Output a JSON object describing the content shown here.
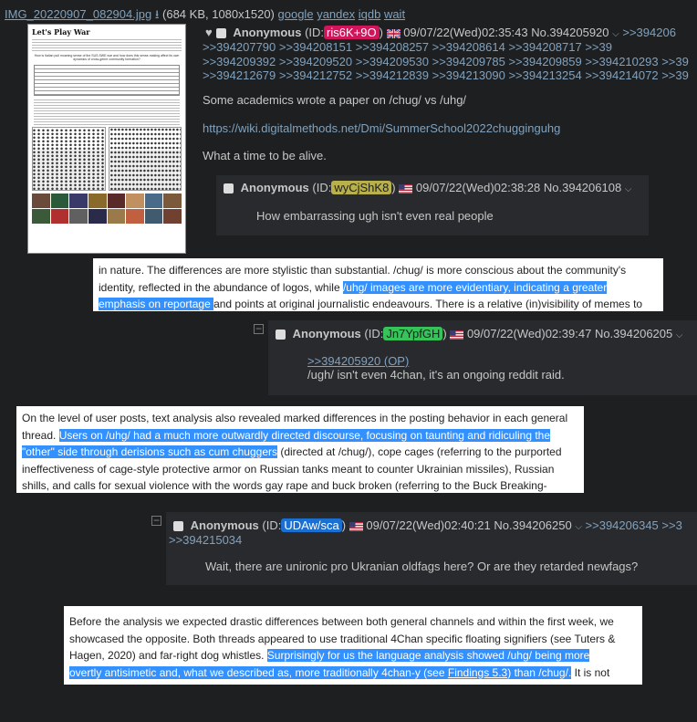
{
  "fileinfo": {
    "filename": "IMG_20220907_082904.jpg",
    "meta": "(684 KB, 1080x1520)",
    "links": [
      "google",
      "yandex",
      "iqdb",
      "wait"
    ]
  },
  "thumbnail": {
    "title": "Let's Play War",
    "caption": "How is Italian pull moaning sense of the SUS.SWE war and how does this sense-making affect its own dynamics of cross-genre community formation?"
  },
  "op": {
    "name": "Anonymous",
    "id_prefix": "(ID:",
    "id": "ris6K+9O",
    "id_suffix": ")",
    "datetime": "09/07/22(Wed)02:35:43",
    "no": "No.394205920",
    "backlinks_row0": ">>394206",
    "backlinks_rows": [
      ">>394207790 >>394208151 >>394208257 >>394208614 >>394208717 >>39",
      ">>394209392 >>394209520 >>394209530 >>394209785 >>394209859 >>394210293 >>39",
      ">>394212679 >>394212752 >>394212839 >>394213090 >>394213254 >>394214072 >>39"
    ],
    "text1": "Some academics wrote a paper on /chug/ vs /uhg/",
    "link": "https://wiki.digitalmethods.net/Dmi/SummerSchool2022chugginguhg",
    "text2": "What a time to be alive."
  },
  "reply1": {
    "name": "Anonymous",
    "id_prefix": "(ID:",
    "id": "wyCjShK8",
    "id_suffix": ")",
    "datetime": "09/07/22(Wed)02:38:28",
    "no": "No.394206108",
    "text": "How embarrassing ugh isn't even real people"
  },
  "popup1": {
    "l1": "in nature. The differences are more stylistic than substantial. /chug/ is more conscious about the community's",
    "l2a": "identity, reflected in the abundance of logos, while ",
    "l2b": "/uhg/ images are more evidentiary, indicating a greater",
    "l3a": "emphasis on reportage ",
    "l3b": "and points at original journalistic endeavours. There is a relative (in)visibility of memes to"
  },
  "reply2": {
    "name": "Anonymous",
    "id_prefix": "(ID:",
    "id": "Jn7YpfGH",
    "id_suffix": ")",
    "datetime": "09/07/22(Wed)02:39:47",
    "no": "No.394206205",
    "quote": ">>394205920 (OP)",
    "text": "/ugh/ isn't even 4chan, it's an ongoing reddit raid."
  },
  "popup2": {
    "l1": "On the level of user posts, text analysis also revealed marked differences in the posting behavior in each general",
    "l2a": "thread. ",
    "l2b": "Users on /uhg/ had a much more outwardly directed discourse, focusing on taunting and ridiculing the",
    "l3a": "\"other\" side through derisions such as cum chuggers",
    "l3b": " (directed at /chug/), cope cages (referring to the purported",
    "l4": "ineffectiveness of cage-style protective armor on Russian tanks meant to counter Ukrainian missiles), Russian",
    "l5": "shills, and calls for sexual violence with the words gay rape and buck broken (referring to the Buck Breaking-"
  },
  "reply3": {
    "name": "Anonymous",
    "id_prefix": "(ID:",
    "id": "UDAw/sca",
    "id_suffix": ")",
    "datetime": "09/07/22(Wed)02:40:21",
    "no": "No.394206250",
    "backlink1": ">>394206345 >>3",
    "backlink2": ">>394215034",
    "text": "Wait, there are unironic pro Ukranian oldfags here? Or are they retarded newfags?"
  },
  "popup3": {
    "l1": "Before the analysis we expected drastic differences between both general channels and within the first week, we",
    "l2": "showcased the opposite. Both threads appeared to use traditional 4Chan specific floating signifiers (see Tuters &",
    "l3a": "Hagen, 2020) and far-right dog whistles. ",
    "l3b": "Surprisingly for us the language analysis showed /uhg/ being more",
    "l4a": "overtly antisimetic and, what we described as, more traditionally 4chan-y (see ",
    "l4b": "Findings 5.3",
    "l4c": ") than /chug/.",
    "l4d": " It is not"
  },
  "colors": {
    "background": "#1d1f21",
    "reply_bg": "#282a2e",
    "link": "#81a2be",
    "selection": "#3390ff",
    "id_op": "#d0155a",
    "id_r1": "#b8b04a",
    "id_r2": "#36c45a",
    "id_r3": "#1a6fd0"
  }
}
